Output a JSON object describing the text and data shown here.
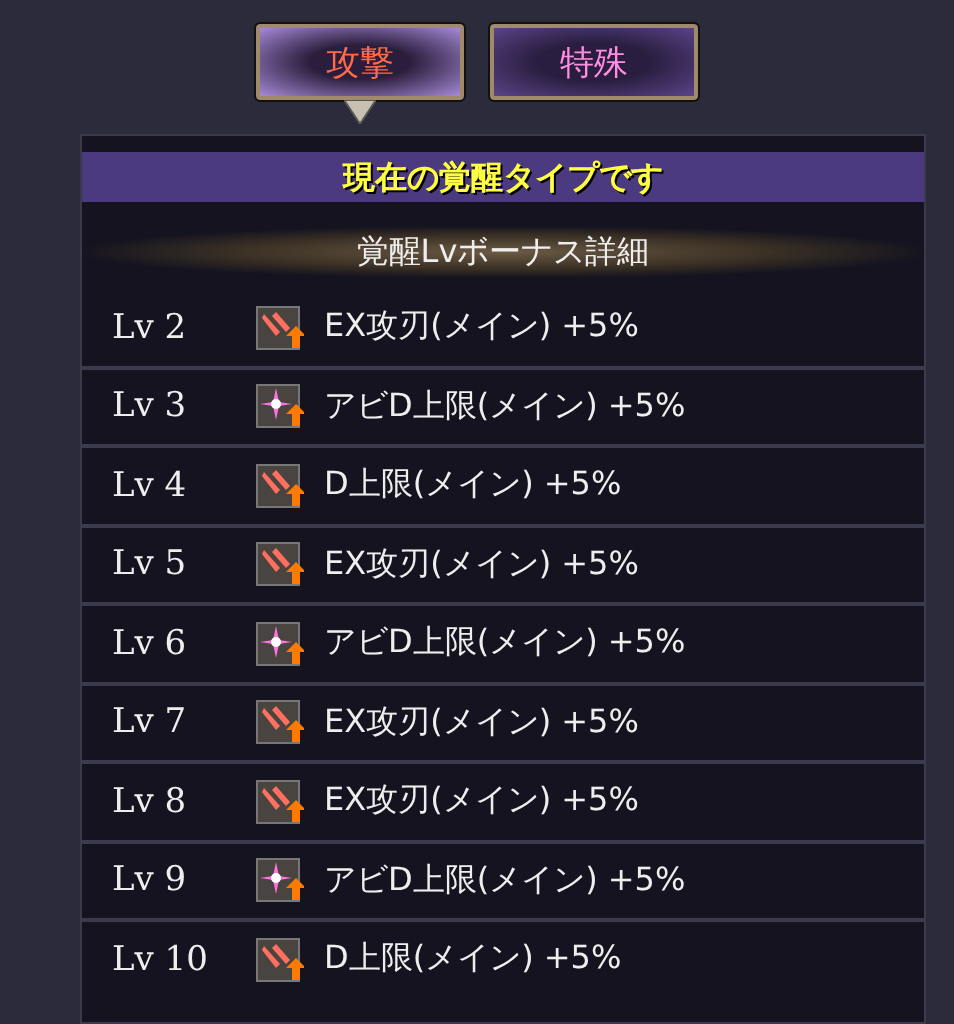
{
  "tabs": [
    {
      "label": "攻撃",
      "selected": true
    },
    {
      "label": "特殊",
      "selected": false
    }
  ],
  "banner": "現在の覚醒タイプです",
  "section_title": "覚醒Lvボーナス詳細",
  "bonuses": [
    {
      "level": "Lv 2",
      "kind": "blades",
      "text": "EX攻刃(メイン) +5%"
    },
    {
      "level": "Lv 3",
      "kind": "spark",
      "text": "アビD上限(メイン) +5%"
    },
    {
      "level": "Lv 4",
      "kind": "blades",
      "text": "D上限(メイン) +5%"
    },
    {
      "level": "Lv 5",
      "kind": "blades",
      "text": "EX攻刃(メイン) +5%"
    },
    {
      "level": "Lv 6",
      "kind": "spark",
      "text": "アビD上限(メイン) +5%"
    },
    {
      "level": "Lv 7",
      "kind": "blades",
      "text": "EX攻刃(メイン) +5%"
    },
    {
      "level": "Lv 8",
      "kind": "blades",
      "text": "EX攻刃(メイン) +5%"
    },
    {
      "level": "Lv 9",
      "kind": "spark",
      "text": "アビD上限(メイン) +5%"
    },
    {
      "level": "Lv 10",
      "kind": "blades",
      "text": "D上限(メイン) +5%"
    }
  ]
}
